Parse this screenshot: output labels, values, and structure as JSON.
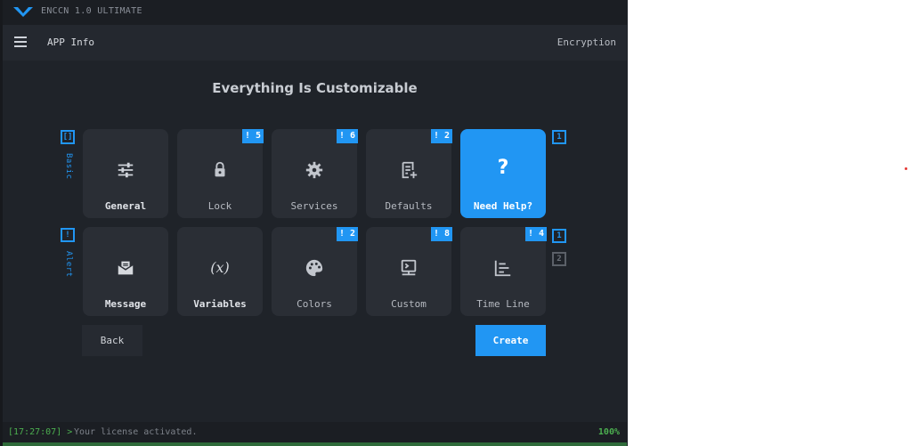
{
  "window": {
    "title": "ENCCN 1.0 ULTIMATE"
  },
  "appbar": {
    "title": "APP Info",
    "right_label": "Encryption",
    "menu_icon": "hamburger-menu-icon"
  },
  "heading": "Everything Is Customizable",
  "sections": [
    {
      "label": "Basic",
      "icon_glyph": "[]"
    },
    {
      "label": "Alert",
      "icon_glyph": "!"
    }
  ],
  "rows": [
    {
      "tiles": [
        {
          "label": "General",
          "icon": "tune-sliders-icon",
          "badge": ""
        },
        {
          "label": "Lock",
          "icon": "lock-icon",
          "badge": "! 5"
        },
        {
          "label": "Services",
          "icon": "gear-icon",
          "badge": "! 6"
        },
        {
          "label": "Defaults",
          "icon": "document-add-icon",
          "badge": "! 2"
        },
        {
          "label": "Need Help?",
          "icon": "question-icon",
          "badge": "",
          "active": true
        }
      ],
      "pager": [
        "1"
      ]
    },
    {
      "tiles": [
        {
          "label": "Message",
          "icon": "mail-icon",
          "badge": ""
        },
        {
          "label": "Variables",
          "icon": "variables-icon",
          "icon_text": "(x)",
          "badge": ""
        },
        {
          "label": "Colors",
          "icon": "palette-icon",
          "badge": "! 2"
        },
        {
          "label": "Custom",
          "icon": "terminal-icon",
          "badge": "! 8"
        },
        {
          "label": "Time Line",
          "icon": "timeline-icon",
          "badge": "! 4"
        }
      ],
      "pager": [
        "1",
        "2"
      ]
    }
  ],
  "buttons": {
    "back": "Back",
    "create": "Create"
  },
  "statusbar": {
    "time": "[17:27:07] >",
    "message": "Your license activated.",
    "progress": "100%"
  },
  "colors": {
    "accent": "#2196f3",
    "background": "#1f2329",
    "tile": "#2a2e35",
    "status_green": "#4caf50"
  }
}
